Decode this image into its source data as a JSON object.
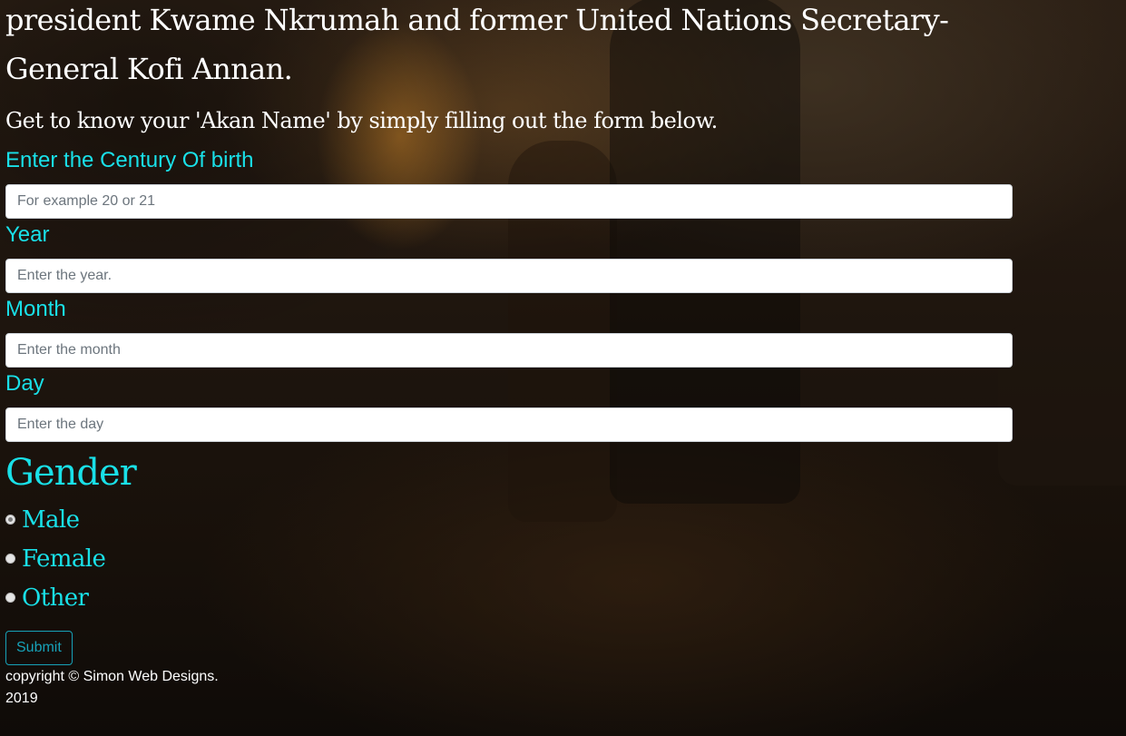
{
  "intro": {
    "text": "president Kwame Nkrumah and former United Nations Secretary-General Kofi Annan."
  },
  "tagline": "Get to know your 'Akan Name' by simply filling out the form below.",
  "form": {
    "century": {
      "label": "Enter the Century Of birth",
      "placeholder": "For example 20 or 21",
      "value": ""
    },
    "year": {
      "label": "Year",
      "placeholder": "Enter the year.",
      "value": ""
    },
    "month": {
      "label": "Month",
      "placeholder": "Enter the month",
      "value": ""
    },
    "day": {
      "label": "Day",
      "placeholder": "Enter the day",
      "value": ""
    },
    "gender": {
      "heading": "Gender",
      "options": [
        {
          "label": "Male",
          "checked": true
        },
        {
          "label": "Female",
          "checked": false
        },
        {
          "label": "Other",
          "checked": false
        }
      ]
    },
    "submit_label": "Submit"
  },
  "footer": {
    "text": "copyright © Simon Web Designs. 2019"
  },
  "colors": {
    "accent": "#19e0e8",
    "button": "#17a2b8",
    "text": "#ffffff"
  }
}
